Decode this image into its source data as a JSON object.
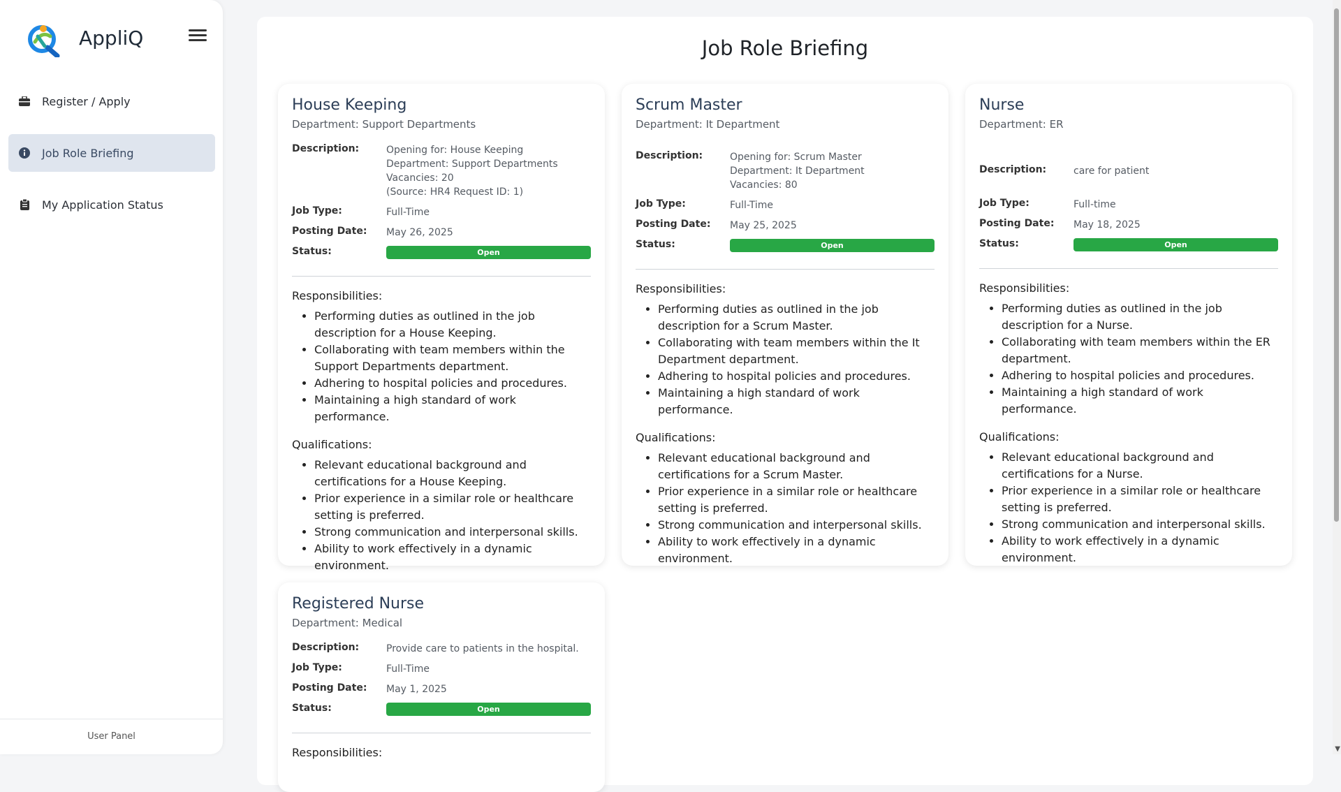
{
  "app": {
    "name": "AppliQ",
    "logo_icon": "person-q-logo-icon",
    "menu_icon": "hamburger-icon"
  },
  "sidebar": {
    "items": [
      {
        "label": "Register / Apply",
        "icon": "briefcase-icon",
        "active": false
      },
      {
        "label": "Job Role Briefing",
        "icon": "info-circle-icon",
        "active": true
      },
      {
        "label": "My Application Status",
        "icon": "clipboard-icon",
        "active": false
      }
    ],
    "footer": "User Panel"
  },
  "page": {
    "title": "Job Role Briefing"
  },
  "labels": {
    "description": "Description:",
    "job_type": "Job Type:",
    "posting_date": "Posting Date:",
    "status": "Status:",
    "responsibilities": "Responsibilities:",
    "qualifications": "Qualifications:"
  },
  "jobs": [
    {
      "title": "House Keeping",
      "department": "Department: Support Departments",
      "description": "Opening for: House Keeping\nDepartment: Support Departments\nVacancies: 20\n(Source: HR4 Request ID: 1)",
      "job_type": "Full-Time",
      "posting_date": "May 26, 2025",
      "status": "Open",
      "responsibilities": [
        "Performing duties as outlined in the job description for a House Keeping.",
        "Collaborating with team members within the Support Departments department.",
        "Adhering to hospital policies and procedures.",
        "Maintaining a high standard of work performance."
      ],
      "qualifications": [
        "Relevant educational background and certifications for a House Keeping.",
        "Prior experience in a similar role or healthcare setting is preferred.",
        "Strong communication and interpersonal skills.",
        "Ability to work effectively in a dynamic environment."
      ]
    },
    {
      "title": "Scrum Master",
      "department": "Department: It Department",
      "description": "Opening for: Scrum Master\nDepartment: It Department\nVacancies: 80",
      "job_type": "Full-Time",
      "posting_date": "May 25, 2025",
      "status": "Open",
      "responsibilities": [
        "Performing duties as outlined in the job description for a Scrum Master.",
        "Collaborating with team members within the It Department department.",
        "Adhering to hospital policies and procedures.",
        "Maintaining a high standard of work performance."
      ],
      "qualifications": [
        "Relevant educational background and certifications for a Scrum Master.",
        "Prior experience in a similar role or healthcare setting is preferred.",
        "Strong communication and interpersonal skills.",
        "Ability to work effectively in a dynamic environment."
      ]
    },
    {
      "title": "Nurse",
      "department": "Department: ER",
      "description": "care for patient",
      "job_type": "Full-time",
      "posting_date": "May 18, 2025",
      "status": "Open",
      "responsibilities": [
        "Performing duties as outlined in the job description for a Nurse.",
        "Collaborating with team members within the ER department.",
        "Adhering to hospital policies and procedures.",
        "Maintaining a high standard of work performance."
      ],
      "qualifications": [
        "Relevant educational background and certifications for a Nurse.",
        "Prior experience in a similar role or healthcare setting is preferred.",
        "Strong communication and interpersonal skills.",
        "Ability to work effectively in a dynamic environment."
      ]
    },
    {
      "title": "Registered Nurse",
      "department": "Department: Medical",
      "description": "Provide care to patients in the hospital.",
      "job_type": "Full-Time",
      "posting_date": "May 1, 2025",
      "status": "Open",
      "responsibilities": [],
      "qualifications": []
    }
  ],
  "colors": {
    "status_open": "#28a745",
    "active_nav_bg": "#dfe5ee",
    "card_title": "#2c3e57"
  }
}
